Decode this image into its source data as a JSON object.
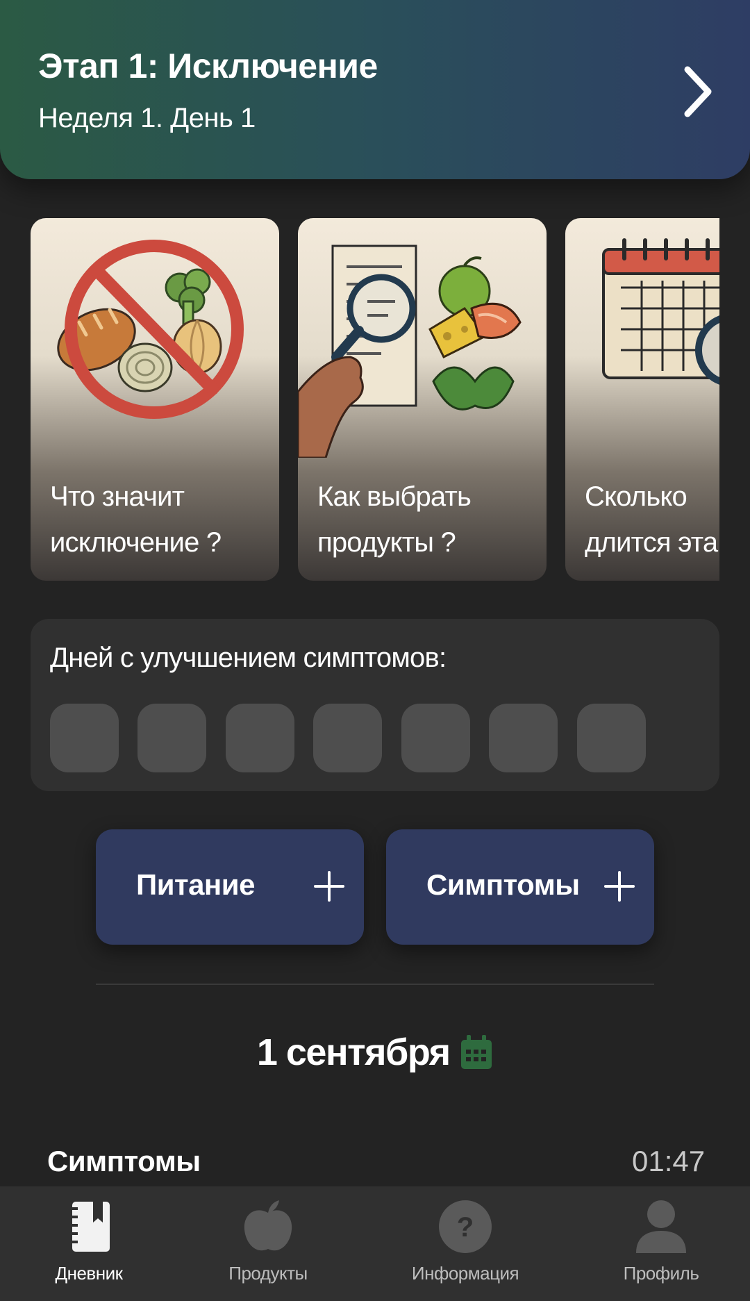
{
  "header": {
    "title": "Этап 1: Исключение",
    "subtitle": "Неделя 1. День 1",
    "chevron_icon": "chevron-right-icon"
  },
  "cards": [
    {
      "line1": "Что значит",
      "line2": "исключение ?",
      "icon": "no-bread-onion-broccoli-illustration"
    },
    {
      "line1": "Как выбрать",
      "line2": "продукты ?",
      "icon": "magnifier-list-food-illustration"
    },
    {
      "line1": "Сколько",
      "line2": "длится этап ?",
      "icon": "calendar-clock-illustration"
    }
  ],
  "improvement": {
    "title": "Дней с улучшением симптомов:",
    "days_marked": 0,
    "days_total": 7
  },
  "actions": {
    "nutrition": "Питание",
    "symptoms": "Симптомы",
    "add_icon": "plus-icon"
  },
  "date": {
    "label": "1 сентября",
    "icon": "calendar-icon",
    "icon_color": "#2e6b3e"
  },
  "symptoms_section": {
    "title": "Симптомы",
    "time": "01:47"
  },
  "nav": [
    {
      "label": "Дневник",
      "icon": "diary-icon",
      "active": true
    },
    {
      "label": "Продукты",
      "icon": "apple-icon",
      "active": false
    },
    {
      "label": "Информация",
      "icon": "help-icon",
      "active": false
    },
    {
      "label": "Профиль",
      "icon": "profile-icon",
      "active": false
    }
  ],
  "colors": {
    "background": "#232323",
    "panel": "#303030",
    "button": "#303a5f",
    "day_cell": "#4e4e4e"
  }
}
